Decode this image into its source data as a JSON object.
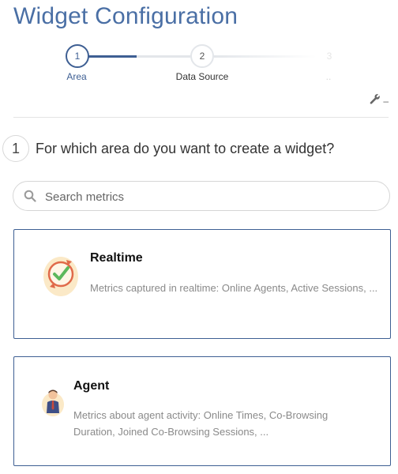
{
  "header": {
    "title": "Widget Configuration"
  },
  "stepper": {
    "steps": [
      {
        "number": "1",
        "label": "Area"
      },
      {
        "number": "2",
        "label": "Data Source"
      },
      {
        "number": "3",
        "label": ".."
      }
    ]
  },
  "tools": {
    "wrench_icon": "wrench-icon",
    "collapse_label": "–"
  },
  "question": {
    "number": "1",
    "text": "For which area do you want to create a widget?"
  },
  "search": {
    "icon": "search-icon",
    "placeholder": "Search metrics",
    "value": ""
  },
  "cards": [
    {
      "icon": "realtime-icon",
      "title": "Realtime",
      "description": "Metrics captured in realtime: Online Agents, Active Sessions, ..."
    },
    {
      "icon": "agent-icon",
      "title": "Agent",
      "description": "Metrics about agent activity: Online Times, Co-Browsing Duration, Joined Co-Browsing Sessions, ..."
    }
  ],
  "colors": {
    "accent": "#3e5f93",
    "title": "#4a6fa5"
  }
}
